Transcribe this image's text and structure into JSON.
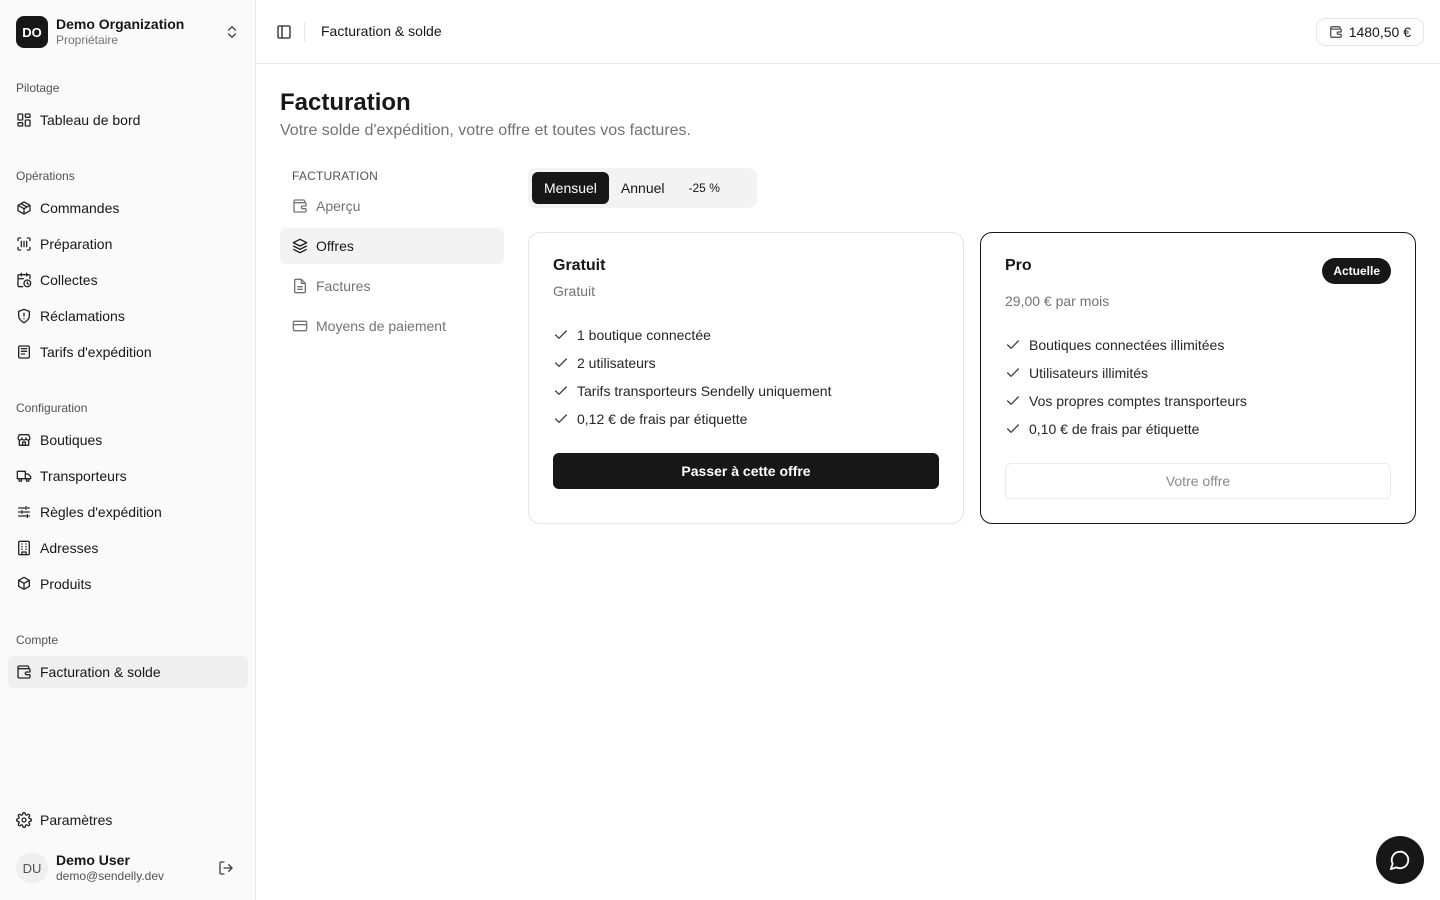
{
  "org": {
    "initials": "DO",
    "name": "Demo Organization",
    "role": "Propriétaire"
  },
  "sidebar": {
    "groups": [
      {
        "label": "Pilotage"
      },
      {
        "label": "Opérations"
      },
      {
        "label": "Configuration"
      },
      {
        "label": "Compte"
      }
    ],
    "items": [
      {
        "label": "Tableau de bord",
        "icon": "dashboard-icon"
      },
      {
        "label": "Commandes",
        "icon": "package-icon"
      },
      {
        "label": "Préparation",
        "icon": "scan-icon"
      },
      {
        "label": "Collectes",
        "icon": "calendar-clock-icon"
      },
      {
        "label": "Réclamations",
        "icon": "shield-icon"
      },
      {
        "label": "Tarifs d'expédition",
        "icon": "receipt-icon"
      },
      {
        "label": "Boutiques",
        "icon": "store-icon"
      },
      {
        "label": "Transporteurs",
        "icon": "truck-icon"
      },
      {
        "label": "Règles d'expédition",
        "icon": "sliders-icon"
      },
      {
        "label": "Adresses",
        "icon": "building-icon"
      },
      {
        "label": "Produits",
        "icon": "packages-icon"
      },
      {
        "label": "Facturation & solde",
        "icon": "wallet-icon",
        "active": true
      }
    ],
    "settings": {
      "label": "Paramètres",
      "icon": "gear-icon"
    }
  },
  "user": {
    "initials": "DU",
    "name": "Demo User",
    "email": "demo@sendelly.dev"
  },
  "header": {
    "title": "Facturation & solde",
    "balance": "1480,50 €"
  },
  "page": {
    "title": "Facturation",
    "subtitle": "Votre solde d'expédition, votre offre et toutes vos factures."
  },
  "subnav": {
    "section_label": "FACTURATION",
    "items": [
      {
        "label": "Aperçu",
        "icon": "wallet-icon"
      },
      {
        "label": "Offres",
        "icon": "layers-icon",
        "active": true
      },
      {
        "label": "Factures",
        "icon": "file-icon"
      },
      {
        "label": "Moyens de paiement",
        "icon": "credit-card-icon"
      }
    ]
  },
  "billing_toggle": {
    "monthly": "Mensuel",
    "yearly": "Annuel",
    "discount": "-25 %",
    "selected": "monthly"
  },
  "plans": [
    {
      "name": "Gratuit",
      "price": "Gratuit",
      "features": [
        "1 boutique connectée",
        "2 utilisateurs",
        "Tarifs transporteurs Sendelly uniquement",
        "0,12 € de frais par étiquette"
      ],
      "cta": "Passer à cette offre"
    },
    {
      "name": "Pro",
      "badge": "Actuelle",
      "price": "29,00 € par mois",
      "features": [
        "Boutiques connectées illimitées",
        "Utilisateurs illimités",
        "Vos propres comptes transporteurs",
        "0,10 € de frais par étiquette"
      ],
      "cta": "Votre offre"
    }
  ],
  "colors": {
    "accent": "#171717",
    "muted": "#737373",
    "border": "#e5e5e5",
    "sidebar_bg": "#fafafa"
  }
}
